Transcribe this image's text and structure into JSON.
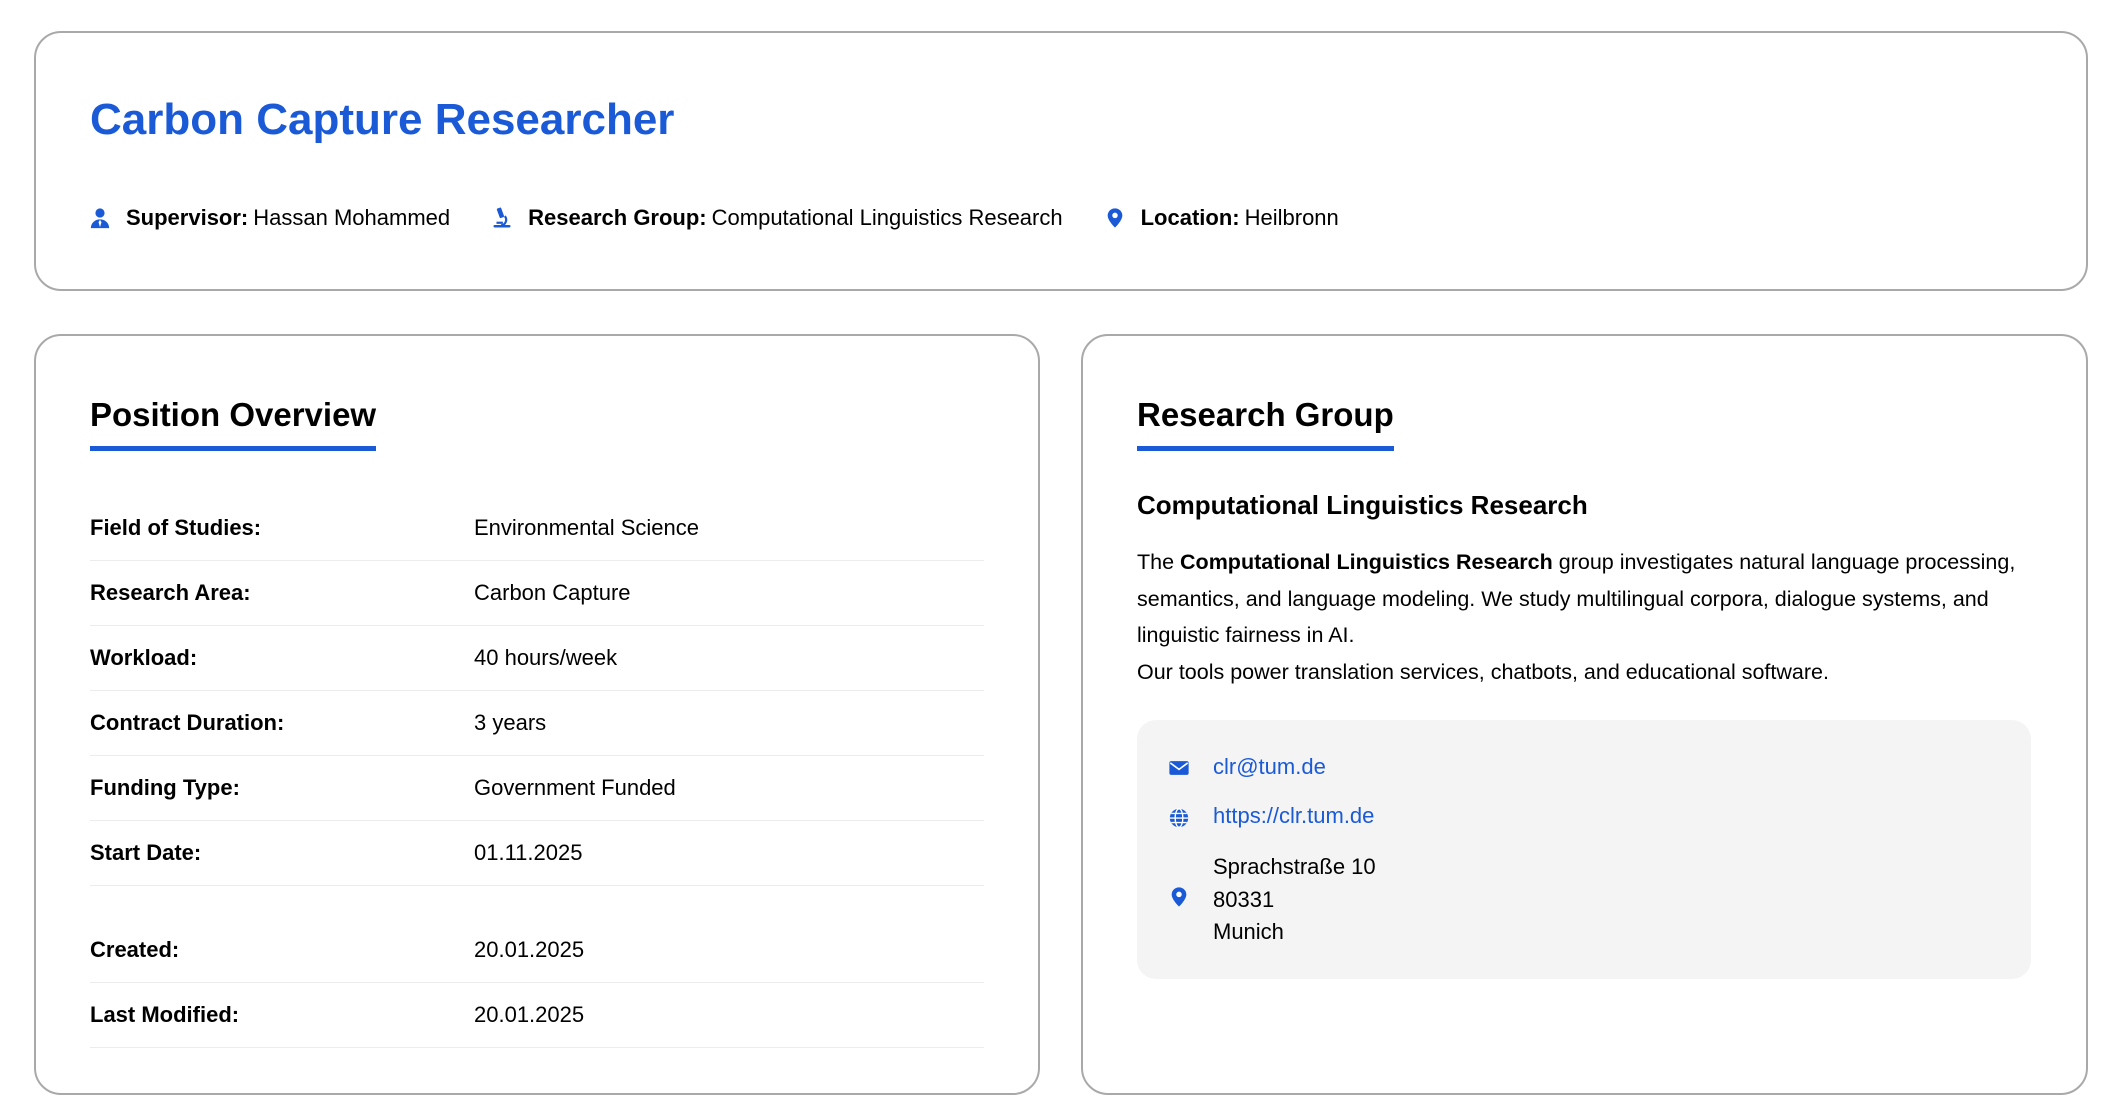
{
  "header": {
    "title": "Carbon Capture Researcher",
    "supervisor_label": "Supervisor:",
    "supervisor_value": "Hassan Mohammed",
    "group_label": "Research Group:",
    "group_value": "Computational Linguistics Research",
    "location_label": "Location:",
    "location_value": "Heilbronn"
  },
  "overview": {
    "title": "Position Overview",
    "rows": [
      {
        "label": "Field of Studies:",
        "value": "Environmental Science"
      },
      {
        "label": "Research Area:",
        "value": "Carbon Capture"
      },
      {
        "label": "Workload:",
        "value": "40 hours/week"
      },
      {
        "label": "Contract Duration:",
        "value": "3 years"
      },
      {
        "label": "Funding Type:",
        "value": "Government Funded"
      },
      {
        "label": "Start Date:",
        "value": "01.11.2025"
      },
      {
        "label": "Created:",
        "value": "20.01.2025"
      },
      {
        "label": "Last Modified:",
        "value": "20.01.2025"
      }
    ]
  },
  "research_group": {
    "title": "Research Group",
    "name": "Computational Linguistics Research",
    "desc_prefix": "The ",
    "desc_bold": "Computational Linguistics Research",
    "desc_rest": " group investigates natural language processing, semantics, and language modeling. We study multilingual corpora, dialogue systems, and linguistic fairness in AI.",
    "desc_line2": "Our tools power translation services, chatbots, and educational software.",
    "email": "clr@tum.de",
    "website": "https://clr.tum.de",
    "address_street": "Sprachstraße 10",
    "address_zip": "80331",
    "address_city": "Munich"
  },
  "icons": {
    "supervisor": "user-tie-icon",
    "group": "microscope-icon",
    "location": "map-pin-icon",
    "email": "envelope-icon",
    "website": "globe-icon",
    "address": "map-pin-icon"
  },
  "colors": {
    "accent": "#1a5ad6",
    "border": "#a9a9a9",
    "contact_bg": "#f4f4f4"
  }
}
